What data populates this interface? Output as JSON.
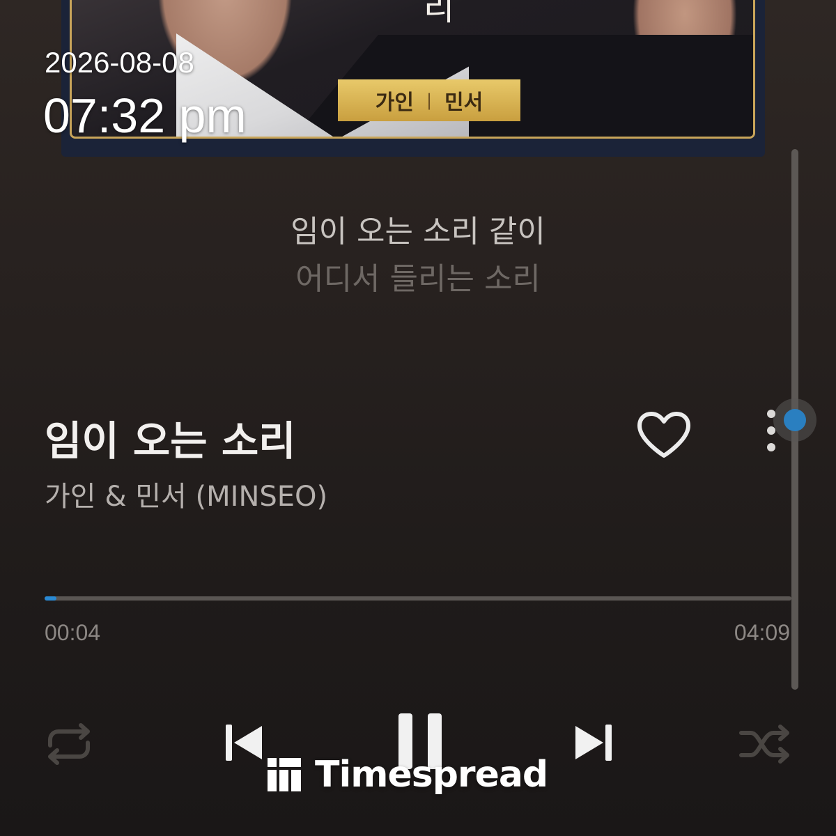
{
  "status": {
    "date": "2026-08-08",
    "time": "07:32 pm"
  },
  "album": {
    "title_glyph": "리",
    "badge_left": "가인",
    "badge_sep": "|",
    "badge_right": "민서"
  },
  "lyrics": {
    "current": "임이 오는 소리 같이",
    "next": "어디서 들리는 소리"
  },
  "song": {
    "title": "임이 오는 소리",
    "artist": "가인 & 민서 (MINSEO)",
    "liked": false
  },
  "progress": {
    "elapsed": "00:04",
    "total": "04:09",
    "fraction": 0.016
  },
  "scroll": {
    "position_fraction": 0.5
  },
  "controls": {
    "repeat_icon": "repeat-icon",
    "prev_icon": "skip-previous-icon",
    "play_state_icon": "pause-icon",
    "next_icon": "skip-next-icon",
    "shuffle_icon": "shuffle-icon",
    "more_icon": "more-vertical-icon",
    "like_icon": "heart-outline-icon"
  },
  "watermark": {
    "text": "Timespread"
  },
  "colors": {
    "accent": "#2a8ad4",
    "background": "#27211f",
    "badge_gold": "#d9b553"
  }
}
